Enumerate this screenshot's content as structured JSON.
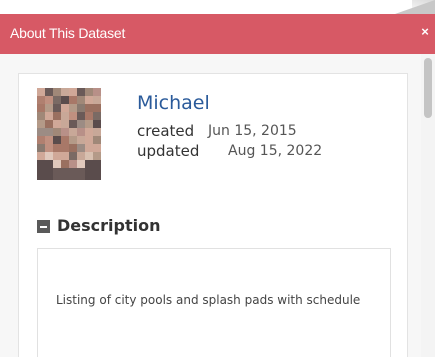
{
  "dialog": {
    "title": "About This Dataset",
    "close_label": "×",
    "colors": {
      "header": "#d75965",
      "owner_link": "#2a5a9a"
    }
  },
  "owner": {
    "name": "Michael",
    "avatar_icon": "user-avatar-pixelated",
    "created_label": "created",
    "created_value": "Jun 15, 2015",
    "updated_label": "updated",
    "updated_value": "Aug 15, 2022"
  },
  "description": {
    "toggle_icon": "collapse-square-icon",
    "heading": "Description",
    "text": "Listing of city pools and splash pads with schedule"
  }
}
